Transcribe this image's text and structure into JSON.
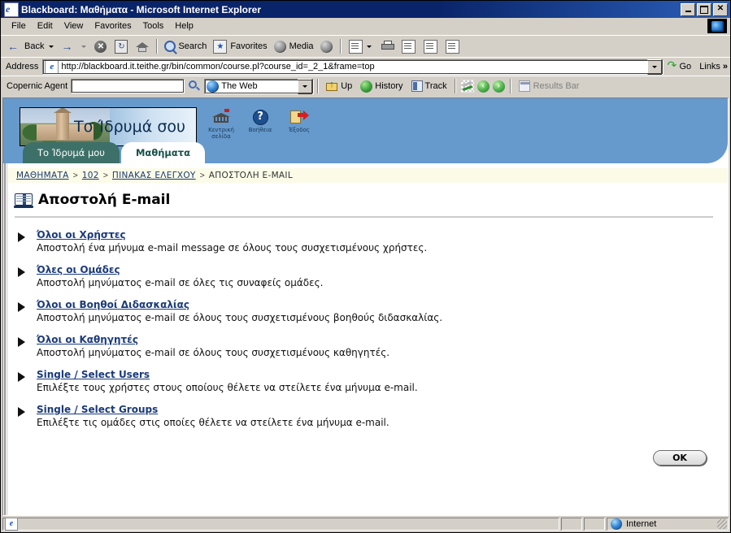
{
  "window": {
    "title": "Blackboard: Μαθήματα - Microsoft Internet Explorer",
    "minimize": "_",
    "maximize": "□",
    "close": "✕"
  },
  "menu": {
    "items": [
      "File",
      "Edit",
      "View",
      "Favorites",
      "Tools",
      "Help"
    ]
  },
  "toolbar": {
    "back": "Back",
    "forward": "",
    "stop_icon": "stop-icon",
    "refresh_icon": "refresh-icon",
    "home_icon": "home-icon",
    "search": "Search",
    "favorites": "Favorites",
    "media": "Media",
    "history_icon": "history-icon",
    "mail_icon": "mail-icon",
    "print_icon": "print-icon",
    "edit_icon": "edit-icon",
    "discuss_icon": "discuss-icon",
    "messenger_icon": "messenger-icon"
  },
  "address": {
    "label": "Address",
    "url": "http://blackboard.it.teithe.gr/bin/common/course.pl?course_id=_2_1&frame=top",
    "go": "Go",
    "links": "Links",
    "chevron": "»"
  },
  "copernic": {
    "label": "Copernic Agent",
    "query": "",
    "placeholder": "",
    "scope": "The Web",
    "up": "Up",
    "history": "History",
    "track": "Track",
    "results_bar": "Results Bar",
    "nav_back": "‹",
    "nav_fwd": "›"
  },
  "blackboard": {
    "banner_text": "Το Ίδρυμά σου",
    "header_icons": [
      {
        "label": "Κεντρική\nσελίδα",
        "icon": "bank-icon"
      },
      {
        "label": "Βοήθεια",
        "icon": "question-icon"
      },
      {
        "label": "Έξοδος",
        "icon": "exit-door-icon"
      }
    ],
    "tabs": [
      {
        "label": "Το Ίδρυμά μου",
        "active": false
      },
      {
        "label": "Μαθήματα",
        "active": true
      }
    ],
    "breadcrumb": [
      {
        "label": "ΜΑΘΗΜΑΤΑ",
        "link": true
      },
      {
        "label": "102",
        "link": true
      },
      {
        "label": "ΠΙΝΑΚΑΣ ΕΛΕΓΧΟΥ",
        "link": true
      },
      {
        "label": "ΑΠΟΣΤΟΛΗ E-MAIL",
        "link": false
      }
    ],
    "breadcrumb_separator": ">",
    "page_title": "Αποστολή E-mail",
    "page_title_icon": "open-book-icon",
    "items": [
      {
        "link": "Όλοι οι Χρήστες",
        "desc": "Αποστολή ένα μήνυμα e-mail message σε όλους τους συσχετισμένους χρήστες."
      },
      {
        "link": "Όλες οι Ομάδες",
        "desc": "Αποστολή μηνύματος e-mail σε όλες τις συναφείς ομάδες."
      },
      {
        "link": "Όλοι οι Βοηθοί Διδασκαλίας",
        "desc": "Αποστολή μηνύματος e-mail σε όλους τους συσχετισμένους βοηθούς διδασκαλίας."
      },
      {
        "link": "Όλοι οι Καθηγητές",
        "desc": "Αποστολή μηνύματος e-mail σε όλους τους συσχετισμένους καθηγητές."
      },
      {
        "link": "Single / Select Users",
        "desc": "Επιλέξτε τους χρήστες στους οποίους θέλετε να στείλετε ένα μήνυμα e-mail."
      },
      {
        "link": "Single / Select Groups",
        "desc": "Επιλέξτε τις ομάδες στις οποίες θέλετε να στείλετε ένα μήνυμα e-mail."
      }
    ],
    "ok_button": "OK"
  },
  "status": {
    "message": "",
    "zone": "Internet"
  },
  "colors": {
    "titlebar": "#0a246a",
    "header_blue": "#6699cc",
    "tab_teal": "#3d7068",
    "link_blue": "#1a3a7a",
    "crumb_bg": "#fbfbe8",
    "chrome": "#d4d0c8"
  }
}
